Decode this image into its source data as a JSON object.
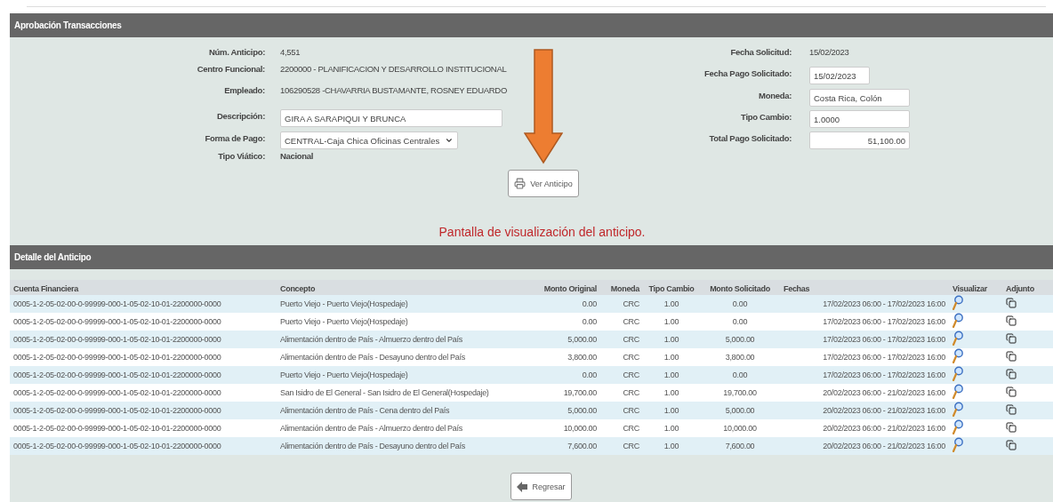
{
  "approval": {
    "title": "Aprobación Transacciones",
    "left_fields": [
      {
        "label": "Núm. Anticipo:",
        "value": "4,551",
        "kind": "text"
      },
      {
        "label": "Centro Funcional:",
        "value": "2200000 - PLANIFICACION Y DESARROLLO INSTITUCIONAL",
        "kind": "text"
      },
      {
        "label": "Empleado:",
        "value": "106290528 -CHAVARRIA BUSTAMANTE, ROSNEY EDUARDO",
        "kind": "text"
      },
      {
        "label": "Descripción:",
        "value": "GIRA A SARAPIQUI Y BRUNCA",
        "kind": "input"
      },
      {
        "label": "Forma de Pago:",
        "value": "CENTRAL-Caja Chica Oficinas Centrales",
        "kind": "select"
      },
      {
        "label": "Tipo Viático:",
        "value": "Nacional",
        "kind": "bold"
      }
    ],
    "right_fields": [
      {
        "label": "Fecha Solicitud:",
        "value": "15/02/2023",
        "kind": "text"
      },
      {
        "label": "Fecha Pago Solicitado:",
        "value": "15/02/2023",
        "kind": "short-input"
      },
      {
        "label": "Moneda:",
        "value": "Costa Rica, Colón",
        "kind": "input"
      },
      {
        "label": "Tipo Cambio:",
        "value": "1.0000",
        "kind": "input"
      },
      {
        "label": "Total Pago Solicitado:",
        "value": "51,100.00",
        "kind": "amount"
      }
    ],
    "view_button": "Ver Anticipo",
    "note": "Pantalla de visualización del anticipo."
  },
  "detail": {
    "title": "Detalle del Anticipo",
    "columns": [
      "Cuenta Financiera",
      "Concepto",
      "Monto Original",
      "Moneda",
      "Tipo Cambio",
      "Monto Solicitado",
      "Fechas",
      "Visualizar",
      "Adjunto"
    ],
    "rows": [
      [
        "0005-1-2-05-02-00-0-99999-000-1-05-02-10-01-2200000-0000",
        "Puerto Viejo - Puerto Viejo(Hospedaje)",
        "0.00",
        "CRC",
        "1.00",
        "0.00",
        "17/02/2023 06:00 - 17/02/2023 16:00"
      ],
      [
        "0005-1-2-05-02-00-0-99999-000-1-05-02-10-01-2200000-0000",
        "Puerto Viejo - Puerto Viejo(Hospedaje)",
        "0.00",
        "CRC",
        "1.00",
        "0.00",
        "17/02/2023 06:00 - 17/02/2023 16:00"
      ],
      [
        "0005-1-2-05-02-00-0-99999-000-1-05-02-10-01-2200000-0000",
        "Alimentación dentro de País - Almuerzo dentro del País",
        "5,000.00",
        "CRC",
        "1.00",
        "5,000.00",
        "17/02/2023 06:00 - 17/02/2023 16:00"
      ],
      [
        "0005-1-2-05-02-00-0-99999-000-1-05-02-10-01-2200000-0000",
        "Alimentación dentro de País - Desayuno dentro del País",
        "3,800.00",
        "CRC",
        "1.00",
        "3,800.00",
        "17/02/2023 06:00 - 17/02/2023 16:00"
      ],
      [
        "0005-1-2-05-02-00-0-99999-000-1-05-02-10-01-2200000-0000",
        "Puerto Viejo - Puerto Viejo(Hospedaje)",
        "0.00",
        "CRC",
        "1.00",
        "0.00",
        "17/02/2023 06:00 - 17/02/2023 16:00"
      ],
      [
        "0005-1-2-05-02-00-0-99999-000-1-05-02-10-01-2200000-0000",
        "San Isidro de El General - San Isidro de El General(Hospedaje)",
        "19,700.00",
        "CRC",
        "1.00",
        "19,700.00",
        "20/02/2023 06:00 - 21/02/2023 16:00"
      ],
      [
        "0005-1-2-05-02-00-0-99999-000-1-05-02-10-01-2200000-0000",
        "Alimentación dentro de País - Cena dentro del País",
        "5,000.00",
        "CRC",
        "1.00",
        "5,000.00",
        "20/02/2023 06:00 - 21/02/2023 16:00"
      ],
      [
        "0005-1-2-05-02-00-0-99999-000-1-05-02-10-01-2200000-0000",
        "Alimentación dentro de País - Almuerzo dentro del País",
        "10,000.00",
        "CRC",
        "1.00",
        "10,000.00",
        "20/02/2023 06:00 - 21/02/2023 16:00"
      ],
      [
        "0005-1-2-05-02-00-0-99999-000-1-05-02-10-01-2200000-0000",
        "Alimentación dentro de País - Desayuno dentro del País",
        "7,600.00",
        "CRC",
        "1.00",
        "7,600.00",
        "20/02/2023 06:00 - 21/02/2023 16:00"
      ]
    ],
    "back_button": "Regresar"
  }
}
